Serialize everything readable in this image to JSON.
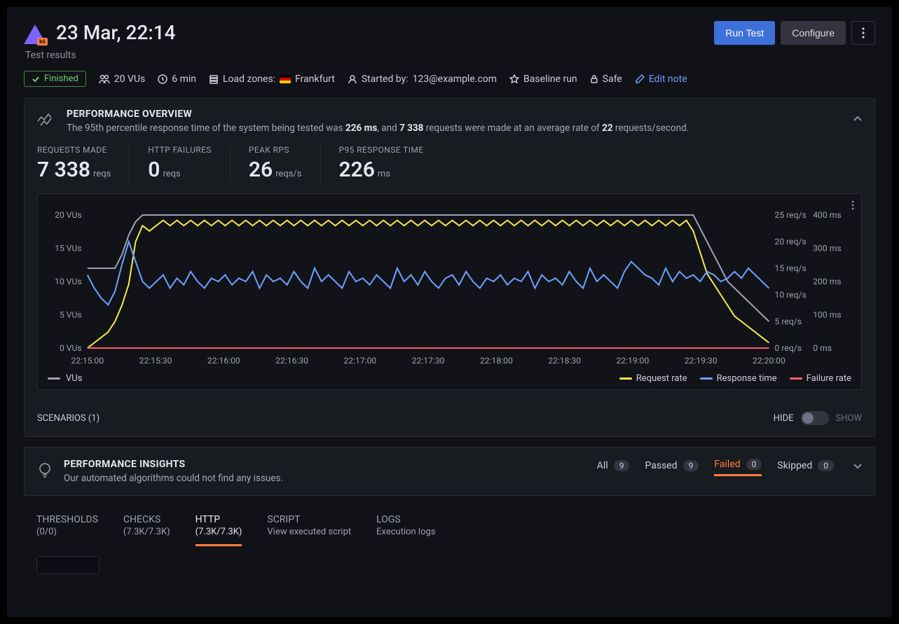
{
  "header": {
    "title": "23 Mar, 22:14",
    "subtitle": "Test results",
    "run_test_label": "Run Test",
    "configure_label": "Configure"
  },
  "meta": {
    "status": "Finished",
    "vus": "20 VUs",
    "duration": "6 min",
    "load_zones_label": "Load zones:",
    "load_zone": "Frankfurt",
    "started_by_label": "Started by:",
    "started_by": "123@example.com",
    "baseline": "Baseline run",
    "safe": "Safe",
    "edit_note": "Edit note"
  },
  "perf": {
    "title": "PERFORMANCE OVERVIEW",
    "desc_prefix": "The 95th percentile response time of the system being tested was ",
    "desc_p95": "226 ms",
    "desc_mid": ", and ",
    "desc_reqs": "7 338",
    "desc_mid2": " requests were made at an average rate of ",
    "desc_rps": "22",
    "desc_suffix": " requests/second."
  },
  "stats": [
    {
      "label": "REQUESTS MADE",
      "value": "7 338",
      "unit": "reqs"
    },
    {
      "label": "HTTP FAILURES",
      "value": "0",
      "unit": "reqs"
    },
    {
      "label": "PEAK RPS",
      "value": "26",
      "unit": "reqs/s"
    },
    {
      "label": "P95 RESPONSE TIME",
      "value": "226",
      "unit": "ms"
    }
  ],
  "chart_data": {
    "type": "line",
    "x_ticks": [
      "22:15:00",
      "22:15:30",
      "22:16:00",
      "22:16:30",
      "22:17:00",
      "22:17:30",
      "22:18:00",
      "22:18:30",
      "22:19:00",
      "22:19:30",
      "22:20:00"
    ],
    "left_axis": {
      "label": "VUs",
      "ticks": [
        "0 VUs",
        "5 VUs",
        "10 VUs",
        "15 VUs",
        "20 VUs"
      ],
      "range": [
        0,
        20
      ]
    },
    "right_axis_1": {
      "label": "req/s",
      "ticks": [
        "0 req/s",
        "5 req/s",
        "10 req/s",
        "15 req/s",
        "20 req/s",
        "25 req/s"
      ],
      "range": [
        0,
        25
      ]
    },
    "right_axis_2": {
      "label": "ms",
      "ticks": [
        "0 ms",
        "100 ms",
        "200 ms",
        "300 ms",
        "400 ms"
      ],
      "range": [
        0,
        400
      ]
    },
    "series": [
      {
        "name": "VUs",
        "color": "#9da0b4",
        "values": [
          12,
          12,
          12,
          12,
          12,
          14,
          17,
          19,
          20,
          20,
          20,
          20,
          20,
          20,
          20,
          20,
          20,
          20,
          20,
          20,
          20,
          20,
          20,
          20,
          20,
          20,
          20,
          20,
          20,
          20,
          20,
          20,
          20,
          20,
          20,
          20,
          20,
          20,
          20,
          20,
          20,
          20,
          20,
          20,
          20,
          20,
          20,
          20,
          20,
          20,
          20,
          20,
          20,
          20,
          20,
          20,
          20,
          20,
          20,
          20,
          20,
          20,
          20,
          20,
          20,
          20,
          20,
          20,
          20,
          20,
          20,
          20,
          20,
          20,
          20,
          20,
          20,
          20,
          20,
          20,
          20,
          20,
          20,
          20,
          20,
          20,
          20,
          20,
          20,
          18,
          16,
          14,
          12,
          10,
          9,
          8,
          7,
          6,
          5,
          4
        ]
      },
      {
        "name": "Request rate",
        "color": "#f2e84b",
        "values": [
          0,
          1,
          2,
          3,
          5,
          8,
          12,
          20,
          23,
          22,
          23,
          24,
          23,
          24,
          23,
          24,
          23,
          24,
          23,
          24,
          23,
          24,
          23,
          24,
          23,
          24,
          23,
          24,
          23,
          24,
          23,
          24,
          23,
          24,
          23,
          24,
          23,
          24,
          23,
          24,
          23,
          24,
          23,
          24,
          23,
          24,
          23,
          24,
          23,
          24,
          23,
          24,
          23,
          24,
          23,
          24,
          23,
          24,
          23,
          24,
          23,
          24,
          23,
          24,
          23,
          24,
          23,
          24,
          23,
          24,
          23,
          24,
          23,
          24,
          23,
          24,
          23,
          24,
          23,
          24,
          23,
          24,
          23,
          24,
          23,
          24,
          23,
          24,
          22,
          18,
          14,
          12,
          10,
          8,
          6,
          5,
          4,
          3,
          2,
          1
        ]
      },
      {
        "name": "Response time",
        "color": "#6e9fff",
        "values": [
          220,
          180,
          150,
          130,
          170,
          250,
          320,
          260,
          200,
          180,
          200,
          220,
          180,
          210,
          190,
          230,
          200,
          180,
          210,
          200,
          220,
          190,
          210,
          200,
          230,
          180,
          220,
          200,
          210,
          190,
          230,
          200,
          180,
          240,
          200,
          220,
          200,
          180,
          230,
          200,
          210,
          190,
          220,
          200,
          180,
          240,
          200,
          220,
          190,
          230,
          200,
          180,
          210,
          220,
          190,
          230,
          200,
          180,
          210,
          200,
          220,
          190,
          210,
          200,
          230,
          180,
          220,
          200,
          210,
          190,
          230,
          200,
          180,
          240,
          200,
          220,
          200,
          180,
          230,
          260,
          240,
          220,
          210,
          190,
          240,
          200,
          230,
          210,
          220,
          200,
          230,
          220,
          200,
          210,
          230,
          210,
          240,
          220,
          200,
          180
        ]
      },
      {
        "name": "Failure rate",
        "color": "#ff5f6d",
        "values": [
          0,
          0,
          0,
          0,
          0,
          0,
          0,
          0,
          0,
          0,
          0,
          0,
          0,
          0,
          0,
          0,
          0,
          0,
          0,
          0,
          0,
          0,
          0,
          0,
          0,
          0,
          0,
          0,
          0,
          0,
          0,
          0,
          0,
          0,
          0,
          0,
          0,
          0,
          0,
          0,
          0,
          0,
          0,
          0,
          0,
          0,
          0,
          0,
          0,
          0,
          0,
          0,
          0,
          0,
          0,
          0,
          0,
          0,
          0,
          0,
          0,
          0,
          0,
          0,
          0,
          0,
          0,
          0,
          0,
          0,
          0,
          0,
          0,
          0,
          0,
          0,
          0,
          0,
          0,
          0,
          0,
          0,
          0,
          0,
          0,
          0,
          0,
          0,
          0,
          0,
          0,
          0,
          0,
          0,
          0,
          0,
          0,
          0,
          0,
          0
        ]
      }
    ],
    "legend": [
      "VUs",
      "Request rate",
      "Response time",
      "Failure rate"
    ]
  },
  "scenarios": {
    "label": "SCENARIOS (1)",
    "hide": "HIDE",
    "show": "SHOW"
  },
  "insights": {
    "title": "PERFORMANCE INSIGHTS",
    "desc": "Our automated algorithms could not find any issues.",
    "tabs": [
      {
        "label": "All",
        "count": "9"
      },
      {
        "label": "Passed",
        "count": "9"
      },
      {
        "label": "Failed",
        "count": "0"
      },
      {
        "label": "Skipped",
        "count": "0"
      }
    ],
    "active_tab": "Failed"
  },
  "tabs": [
    {
      "label": "THRESHOLDS",
      "sub": "(0/0)"
    },
    {
      "label": "CHECKS",
      "sub": "(7.3K/7.3K)"
    },
    {
      "label": "HTTP",
      "sub": "(7.3K/7.3K)"
    },
    {
      "label": "SCRIPT",
      "sub": "View executed script"
    },
    {
      "label": "LOGS",
      "sub": "Execution logs"
    }
  ],
  "active_tab": "HTTP"
}
